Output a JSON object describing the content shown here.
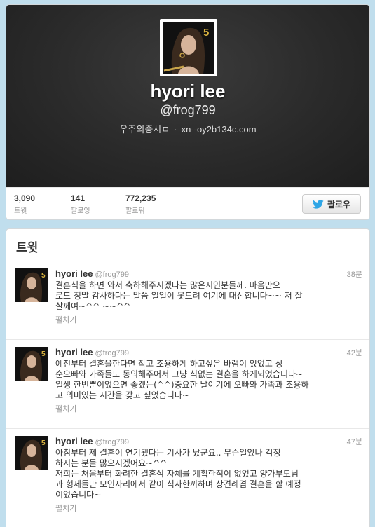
{
  "profile": {
    "name": "hyori lee",
    "handle": "@frog799",
    "location": "우주의중시ㅁ",
    "website": "xn--oy2b134c.com",
    "avatar_badge": "5"
  },
  "stats": [
    {
      "value": "3,090",
      "label": "트윗"
    },
    {
      "value": "141",
      "label": "팔로잉"
    },
    {
      "value": "772,235",
      "label": "팔로워"
    }
  ],
  "follow_button": {
    "label": "팔로우"
  },
  "tweets_section": {
    "heading": "트윗",
    "items": [
      {
        "name": "hyori lee",
        "handle": "@frog799",
        "time": "38분",
        "lines": [
          "결혼식을 하면 와서 축하해주시겠다는 많은지인분들께. 마음만으",
          "로도 정말 감사하다는 말씀 일일이 못드려 여기에 대신합니다~~ 저 잘",
          "살께여~^^ ~~^^"
        ],
        "expand": "펼치기"
      },
      {
        "name": "hyori lee",
        "handle": "@frog799",
        "time": "42분",
        "lines": [
          "예전부터 결혼을한다면 작고 조용하게 하고싶은 바램이 있었고 상",
          "순오빠와 가족들도 동의해주어서 그냥 식없는 결혼을 하게되었습니다~",
          "일생 한번뿐이었으면 좋겠는(^^)중요한 날이기에 오빠와 가족과 조용하",
          "고 의미있는 시간을 갖고 싶었습니다~"
        ],
        "expand": "펼치기"
      },
      {
        "name": "hyori lee",
        "handle": "@frog799",
        "time": "47분",
        "lines": [
          "아침부터 제 결혼이 연기됐다는 기사가 났군요.. 무슨일있나 걱정",
          "하시는 분들 많으시겠어요~^^",
          "저희는 처음부터 화려한  결혼식 자체를 계획한적이 없었고 양가부모님",
          "과 형제들만 모인자리에서 같이 식사한끼하며 상견례겸 결혼을 할 예정",
          "이었습니다~"
        ],
        "expand": "펼치기"
      }
    ]
  },
  "colors": {
    "background": "#c0deed",
    "twitter_blue": "#2fa6e6"
  }
}
